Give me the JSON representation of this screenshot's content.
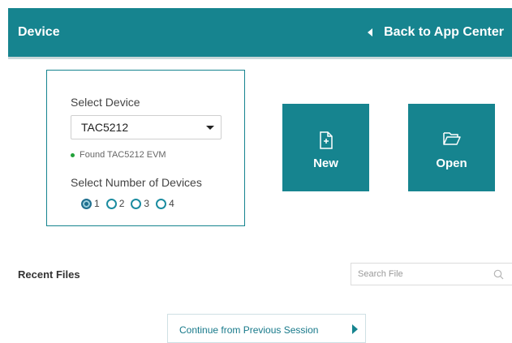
{
  "header": {
    "title": "Device",
    "back_label": "Back to App Center"
  },
  "device_panel": {
    "select_label": "Select Device",
    "selected_device": "TAC5212",
    "status_text": "Found TAC5212 EVM",
    "count_label": "Select Number of Devices",
    "count_options": [
      "1",
      "2",
      "3",
      "4"
    ],
    "selected_count": "1"
  },
  "actions": {
    "new_label": "New",
    "open_label": "Open"
  },
  "recent": {
    "title": "Recent Files",
    "search_placeholder": "Search File"
  },
  "continue_label": "Continue from Previous Session",
  "colors": {
    "accent": "#16848f",
    "status_dot": "#23a23a"
  },
  "icons": [
    "back-arrow-icon",
    "dropdown-caret-icon",
    "new-file-icon",
    "folder-open-icon",
    "search-icon",
    "chevron-right-icon"
  ]
}
